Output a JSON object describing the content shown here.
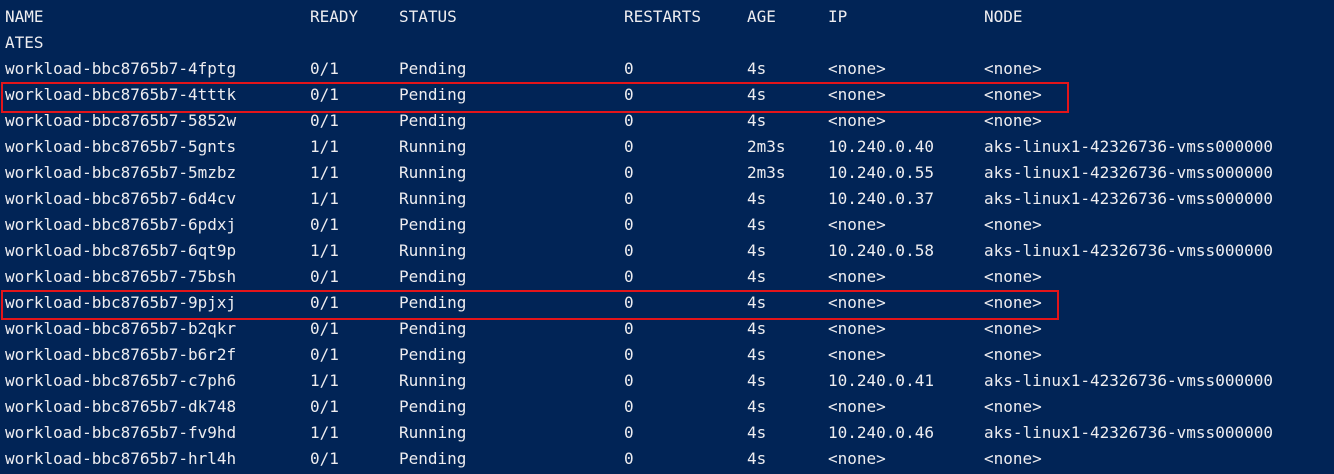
{
  "window": {
    "colors": {
      "background": "#012456",
      "foreground": "#eeedf0",
      "highlight_box": "#e3151a"
    }
  },
  "table": {
    "headers": {
      "name": "NAME",
      "ready": "READY",
      "status": "STATUS",
      "restarts": "RESTARTS",
      "age": "AGE",
      "ip": "IP",
      "node": "NODE"
    },
    "wrapped_header": "ATES",
    "rows": [
      {
        "name": "workload-bbc8765b7-4fptg",
        "ready": "0/1",
        "status": "Pending",
        "restarts": "0",
        "age": "4s",
        "ip": "<none>",
        "node": "<none>"
      },
      {
        "name": "workload-bbc8765b7-4tttk",
        "ready": "0/1",
        "status": "Pending",
        "restarts": "0",
        "age": "4s",
        "ip": "<none>",
        "node": "<none>"
      },
      {
        "name": "workload-bbc8765b7-5852w",
        "ready": "0/1",
        "status": "Pending",
        "restarts": "0",
        "age": "4s",
        "ip": "<none>",
        "node": "<none>"
      },
      {
        "name": "workload-bbc8765b7-5gnts",
        "ready": "1/1",
        "status": "Running",
        "restarts": "0",
        "age": "2m3s",
        "ip": "10.240.0.40",
        "node": "aks-linux1-42326736-vmss000000"
      },
      {
        "name": "workload-bbc8765b7-5mzbz",
        "ready": "1/1",
        "status": "Running",
        "restarts": "0",
        "age": "2m3s",
        "ip": "10.240.0.55",
        "node": "aks-linux1-42326736-vmss000000"
      },
      {
        "name": "workload-bbc8765b7-6d4cv",
        "ready": "1/1",
        "status": "Running",
        "restarts": "0",
        "age": "4s",
        "ip": "10.240.0.37",
        "node": "aks-linux1-42326736-vmss000000"
      },
      {
        "name": "workload-bbc8765b7-6pdxj",
        "ready": "0/1",
        "status": "Pending",
        "restarts": "0",
        "age": "4s",
        "ip": "<none>",
        "node": "<none>"
      },
      {
        "name": "workload-bbc8765b7-6qt9p",
        "ready": "1/1",
        "status": "Running",
        "restarts": "0",
        "age": "4s",
        "ip": "10.240.0.58",
        "node": "aks-linux1-42326736-vmss000000"
      },
      {
        "name": "workload-bbc8765b7-75bsh",
        "ready": "0/1",
        "status": "Pending",
        "restarts": "0",
        "age": "4s",
        "ip": "<none>",
        "node": "<none>"
      },
      {
        "name": "workload-bbc8765b7-9pjxj",
        "ready": "0/1",
        "status": "Pending",
        "restarts": "0",
        "age": "4s",
        "ip": "<none>",
        "node": "<none>"
      },
      {
        "name": "workload-bbc8765b7-b2qkr",
        "ready": "0/1",
        "status": "Pending",
        "restarts": "0",
        "age": "4s",
        "ip": "<none>",
        "node": "<none>"
      },
      {
        "name": "workload-bbc8765b7-b6r2f",
        "ready": "0/1",
        "status": "Pending",
        "restarts": "0",
        "age": "4s",
        "ip": "<none>",
        "node": "<none>"
      },
      {
        "name": "workload-bbc8765b7-c7ph6",
        "ready": "1/1",
        "status": "Running",
        "restarts": "0",
        "age": "4s",
        "ip": "10.240.0.41",
        "node": "aks-linux1-42326736-vmss000000"
      },
      {
        "name": "workload-bbc8765b7-dk748",
        "ready": "0/1",
        "status": "Pending",
        "restarts": "0",
        "age": "4s",
        "ip": "<none>",
        "node": "<none>"
      },
      {
        "name": "workload-bbc8765b7-fv9hd",
        "ready": "1/1",
        "status": "Running",
        "restarts": "0",
        "age": "4s",
        "ip": "10.240.0.46",
        "node": "aks-linux1-42326736-vmss000000"
      },
      {
        "name": "workload-bbc8765b7-hrl4h",
        "ready": "0/1",
        "status": "Pending",
        "restarts": "0",
        "age": "4s",
        "ip": "<none>",
        "node": "<none>"
      }
    ]
  }
}
